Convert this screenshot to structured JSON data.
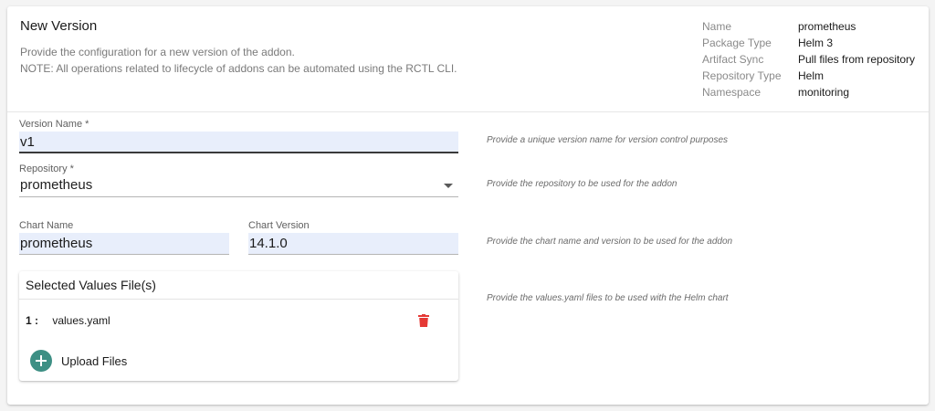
{
  "header": {
    "title": "New Version",
    "description_line1": "Provide the configuration for a new version of the addon.",
    "description_line2": "NOTE: All operations related to lifecycle of addons can be automated using the RCTL CLI."
  },
  "meta": [
    {
      "label": "Name",
      "value": "prometheus"
    },
    {
      "label": "Package Type",
      "value": "Helm 3"
    },
    {
      "label": "Artifact Sync",
      "value": "Pull files from repository"
    },
    {
      "label": "Repository Type",
      "value": "Helm"
    },
    {
      "label": "Namespace",
      "value": "monitoring"
    }
  ],
  "form": {
    "version_name": {
      "label": "Version Name *",
      "value": "v1",
      "hint": "Provide a unique version name for version control purposes"
    },
    "repository": {
      "label": "Repository *",
      "value": "prometheus",
      "hint": "Provide the repository to be used for the addon"
    },
    "chart_name": {
      "label": "Chart Name",
      "value": "prometheus"
    },
    "chart_version": {
      "label": "Chart Version",
      "value": "14.1.0"
    },
    "chart_hint": "Provide the chart name and version to be used for the addon",
    "values_hint": "Provide the values.yaml files to be used with the Helm chart"
  },
  "values_files": {
    "title": "Selected Values File(s)",
    "files": [
      {
        "index": "1 :",
        "name": "values.yaml"
      }
    ],
    "upload_label": "Upload Files"
  },
  "colors": {
    "accent": "#3d8f84",
    "delete": "#e53935",
    "input_fill": "#e8eefb"
  },
  "icons": {
    "delete": "trash-icon",
    "upload": "plus-circle-icon",
    "dropdown": "caret-down-icon"
  }
}
